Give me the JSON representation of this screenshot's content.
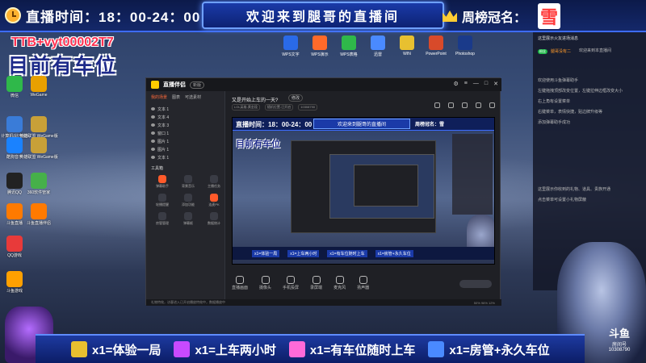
{
  "top": {
    "timer_label": "直播时间：18：00-24：00",
    "welcome": "欢迎来到腿哥的直播间",
    "rank_label": "周榜冠名：",
    "rank_name": "雪"
  },
  "overlay": {
    "qq": "TTB+vyt00002T7",
    "car": "目前有车位"
  },
  "desktop_icons_left": [
    {
      "label": "微信",
      "color": "#2fb84a"
    },
    {
      "label": "WeGame",
      "color": "#e8a000"
    },
    {
      "label": "计算机(此电脑)",
      "color": "#3a7cd8"
    },
    {
      "label": "英雄联盟 WeGame版",
      "color": "#c8a038"
    },
    {
      "label": "酷狗音乐",
      "color": "#1a82ff"
    },
    {
      "label": "英雄联盟 WeGame版",
      "color": "#c8a038"
    },
    {
      "label": "腾讯QQ",
      "color": "#222222"
    },
    {
      "label": "360软件管家",
      "color": "#46b04a"
    },
    {
      "label": "斗鱼直播",
      "color": "#ff7a00"
    },
    {
      "label": "斗鱼直播伴侣",
      "color": "#ff7a00"
    },
    {
      "label": "QQ游戏",
      "color": "#e83a3a"
    },
    {
      "label": "斗鱼游戏",
      "color": "#ffa000"
    }
  ],
  "desktop_icons_top": [
    {
      "label": "WPS文字",
      "color": "#2a6ae8"
    },
    {
      "label": "WPS演示",
      "color": "#ff6a2a"
    },
    {
      "label": "WPS表格",
      "color": "#2fb84a"
    },
    {
      "label": "迅雷",
      "color": "#4a8aff"
    },
    {
      "label": "WIN",
      "color": "#e8c030"
    },
    {
      "label": "PowerPoint",
      "color": "#d84a2a"
    },
    {
      "label": "Photoshop",
      "color": "#1a3a8a"
    }
  ],
  "app": {
    "name": "直播伴侣",
    "version": "新版",
    "side_tabs": [
      "我的场景",
      "图表",
      "可选素材"
    ],
    "sources": [
      "文本 1",
      "文本 4",
      "文本 3",
      "窗口 1",
      "图片 1",
      "图片 1",
      "文本 1"
    ],
    "tools_title": "工具箱",
    "tools": [
      {
        "label": "弹幕助手",
        "hot": true
      },
      {
        "label": "背景音乐",
        "hot": false
      },
      {
        "label": "主播任务",
        "hot": false
      },
      {
        "label": "轮播提醒",
        "hot": false
      },
      {
        "label": "添加功能",
        "hot": false
      },
      {
        "label": "连麦PK",
        "hot": true
      },
      {
        "label": "房管管理",
        "hot": false
      },
      {
        "label": "弹幕姬",
        "hot": false
      },
      {
        "label": "数据统计",
        "hot": false
      }
    ],
    "room_title": "又是开始上车的一天?",
    "room_edit": "修改",
    "room_meta": [
      "LOL英雄-黄金段",
      "随机位置-已开启",
      "10308790"
    ],
    "controls": [
      {
        "label": "直播画面"
      },
      {
        "label": "摄像头"
      },
      {
        "label": "手机投屏"
      },
      {
        "label": "录屏端"
      },
      {
        "label": "麦克风"
      },
      {
        "label": "扬声器"
      }
    ],
    "status": "礼物特效，访客进入已开启播放特效中，数据播放中",
    "status_right": "50%  96%  12%"
  },
  "preview": {
    "timer": "直播时间：18：00-24：00",
    "welcome": "欢迎来到腿哥的直播间",
    "rank": "周榜冠名：雪",
    "car": "目前有车位",
    "rewards": [
      "x1=体验一局",
      "x1=上车两小时",
      "x1=有车位随时上车",
      "x1=房管+永久车位"
    ]
  },
  "right_panel": {
    "header": "这里展示火友进场消息",
    "badge": "粉丝",
    "user": "腿哥没有二",
    "user_action": "欢迎来到本直播间",
    "help_lines": [
      "欢迎使用斗鱼弹幕助手",
      "左键拖拽顶部改变位置，左键拉伸边框改变大小",
      "右上角有设置菜单",
      "右键菜单，表情快捷，贴边牌升级等",
      "添加弹幕助手成功"
    ],
    "footer_lines": [
      "这里展示你收到的礼物、道具、贵族开通",
      "点击菜单可设置小礼物屏蔽"
    ]
  },
  "bottom": {
    "rewards": [
      {
        "text": "x1=体验一局",
        "color": "#e8c030"
      },
      {
        "text": "x1=上车两小时",
        "color": "#c84aff"
      },
      {
        "text": "x1=有车位随时上车",
        "color": "#ff6ad8"
      },
      {
        "text": "x1=房管+永久车位",
        "color": "#4a8aff"
      }
    ],
    "room_logo": "斗鱼",
    "room_label": "房间号",
    "room_number": "10308790"
  }
}
